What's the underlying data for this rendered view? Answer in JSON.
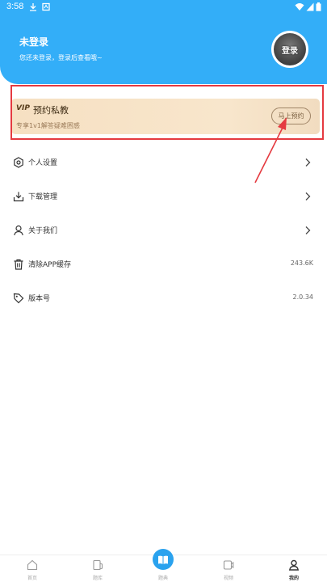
{
  "status_bar": {
    "time": "3:58"
  },
  "header": {
    "title": "未登录",
    "subtitle": "您还未登录，登录后查看哦~",
    "avatar_label": "登录"
  },
  "vip": {
    "logo": "VIP",
    "title": "预约私教",
    "subtitle": "专享1v1解答疑难困惑",
    "button": "马上预约"
  },
  "menu": [
    {
      "label": "个人设置",
      "icon": "hexagon-settings-icon",
      "chevron": true
    },
    {
      "label": "下载管理",
      "icon": "download-tray-icon",
      "chevron": true
    },
    {
      "label": "关于我们",
      "icon": "person-icon",
      "chevron": true
    },
    {
      "label": "清除APP缓存",
      "icon": "trash-icon",
      "value": "243.6K"
    },
    {
      "label": "版本号",
      "icon": "version-tag-icon",
      "value": "2.0.34"
    }
  ],
  "bottom_nav": [
    {
      "label": "首页",
      "icon": "home-icon"
    },
    {
      "label": "题库",
      "icon": "question-bank-icon"
    },
    {
      "label": "题典",
      "icon": "book-icon"
    },
    {
      "label": "视频",
      "icon": "video-icon"
    },
    {
      "label": "我的",
      "icon": "profile-icon",
      "active": true
    }
  ],
  "colors": {
    "header_bg": "#33aef8",
    "vip_bg": "#f6e0c2",
    "highlight": "#e53a40",
    "nav_active": "#2aa2ee"
  }
}
